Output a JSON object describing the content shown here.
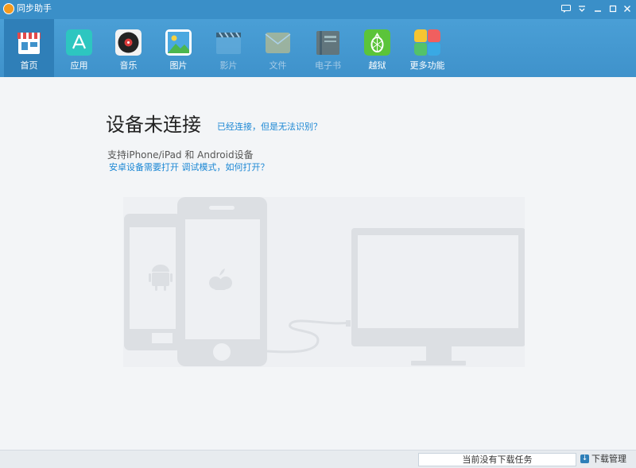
{
  "window": {
    "title": "同步助手",
    "controls": [
      "feedback-icon",
      "menu-icon",
      "minimize-icon",
      "maximize-icon",
      "close-icon"
    ]
  },
  "toolbar": {
    "tabs": [
      {
        "label": "首页",
        "icon": "store-icon",
        "state": "active"
      },
      {
        "label": "应用",
        "icon": "app-store-icon",
        "state": "normal"
      },
      {
        "label": "音乐",
        "icon": "music-disc-icon",
        "state": "normal"
      },
      {
        "label": "图片",
        "icon": "picture-icon",
        "state": "normal"
      },
      {
        "label": "影片",
        "icon": "clapperboard-icon",
        "state": "disabled"
      },
      {
        "label": "文件",
        "icon": "envelope-icon",
        "state": "disabled"
      },
      {
        "label": "电子书",
        "icon": "book-icon",
        "state": "disabled"
      },
      {
        "label": "越狱",
        "icon": "pineapple-icon",
        "state": "normal"
      },
      {
        "label": "更多功能",
        "icon": "more-tiles-icon",
        "state": "normal"
      }
    ]
  },
  "main": {
    "heading": "设备未连接",
    "help_link": "已经连接，但是无法识别？",
    "support_text": "支持iPhone/iPad 和 Android设备",
    "android_link": "安卓设备需要打开 调试模式，如何打开？"
  },
  "statusbar": {
    "task_status": "当前没有下载任务",
    "download_manager": "下载管理"
  },
  "colors": {
    "titlebar": "#3a8fc8",
    "toolbar": "#4a9fd6",
    "active_tab": "#2f7fb8",
    "link": "#1b87d4",
    "illustration": "#dcdfe3"
  }
}
